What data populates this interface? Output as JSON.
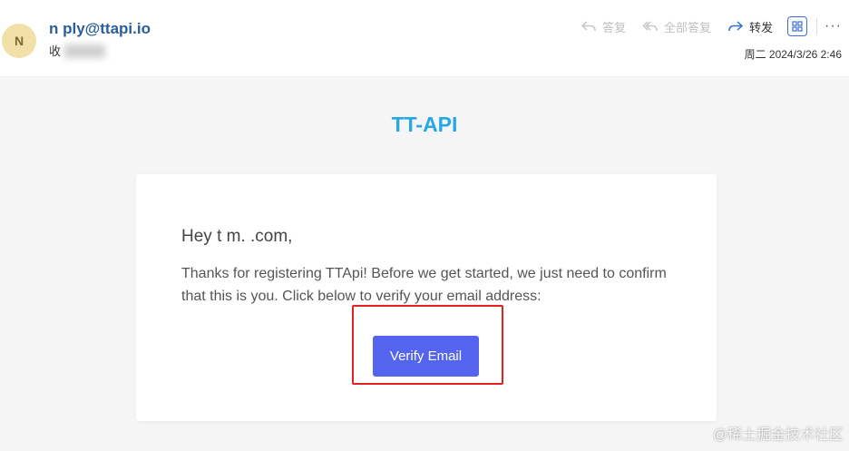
{
  "header": {
    "avatar_initial": "N",
    "sender": "n  ply@ttapi.io",
    "recipient_label": "收",
    "recipient_value": "masked",
    "reply_label": "答复",
    "reply_all_label": "全部答复",
    "forward_label": "转发",
    "datetime": "周二 2024/3/26 2:46",
    "more_label": "···"
  },
  "email": {
    "brand": "TT-API",
    "greeting": "Hey t  m.  .com,",
    "message": "Thanks for registering TTApi! Before we get started, we just need to confirm that this is you. Click below to verify your email address:",
    "verify_button": "Verify Email"
  },
  "watermark": "@稀土掘金技术社区",
  "colors": {
    "brand": "#27a8e6",
    "button": "#5464ef",
    "highlight": "#e4231e",
    "sender": "#2a5d9b"
  }
}
